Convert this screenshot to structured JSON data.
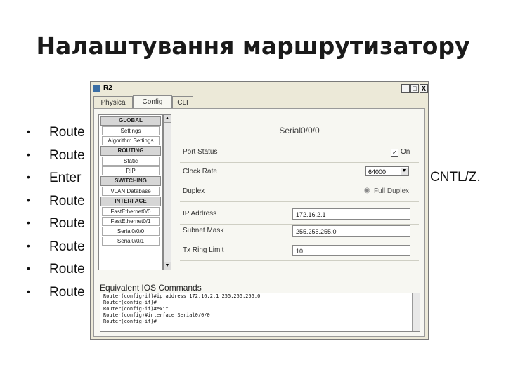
{
  "slide": {
    "title": "Налаштування маршрутизатору",
    "bullets": [
      "Route",
      "Route",
      "Enter",
      "Route",
      "Route",
      "Route",
      "Route",
      "Route"
    ],
    "tail_text": "CNTL/Z."
  },
  "window": {
    "title": "R2",
    "controls": {
      "minimize": "_",
      "maximize": "□",
      "close": "X"
    },
    "tabs": [
      "Physica",
      "Config",
      "CLI"
    ],
    "active_tab": "Config"
  },
  "config_list": {
    "sections": [
      {
        "label": "GLOBAL",
        "items": [
          "Settings",
          "Algorithm Settings"
        ]
      },
      {
        "label": "ROUTING",
        "items": [
          "Static",
          "RIP"
        ]
      },
      {
        "label": "SWITCHING",
        "items": [
          "VLAN Database"
        ]
      },
      {
        "label": "INTERFACE",
        "items": [
          "FastEthernet0/0",
          "FastEthernet0/1",
          "Serial0/0/0",
          "Serial0/0/1"
        ]
      }
    ]
  },
  "interface_panel": {
    "heading": "Serial0/0/0",
    "port_status": {
      "label": "Port Status",
      "checkbox_label": "On",
      "checked": true
    },
    "clock_rate": {
      "label": "Clock Rate",
      "value": "64000"
    },
    "duplex": {
      "label": "Duplex",
      "value": "Full Duplex"
    },
    "ip_address": {
      "label": "IP Address",
      "value": "172.16.2.1"
    },
    "subnet_mask": {
      "label": "Subnet Mask",
      "value": "255.255.255.0"
    },
    "tx_ring_limit": {
      "label": "Tx Ring Limit",
      "value": "10"
    }
  },
  "ics": {
    "title": "Equivalent IOS Commands",
    "lines": [
      "Router(config-if)#ip address 172.16.2.1 255.255.255.0",
      "Router(config-if)#",
      "Router(config-if)#exit",
      "Router(config)#interface Serial0/0/0",
      "Router(config-if)#"
    ]
  },
  "colors": {
    "window_bg": "#ece9d8",
    "panel_bg": "#f7f7f2"
  }
}
